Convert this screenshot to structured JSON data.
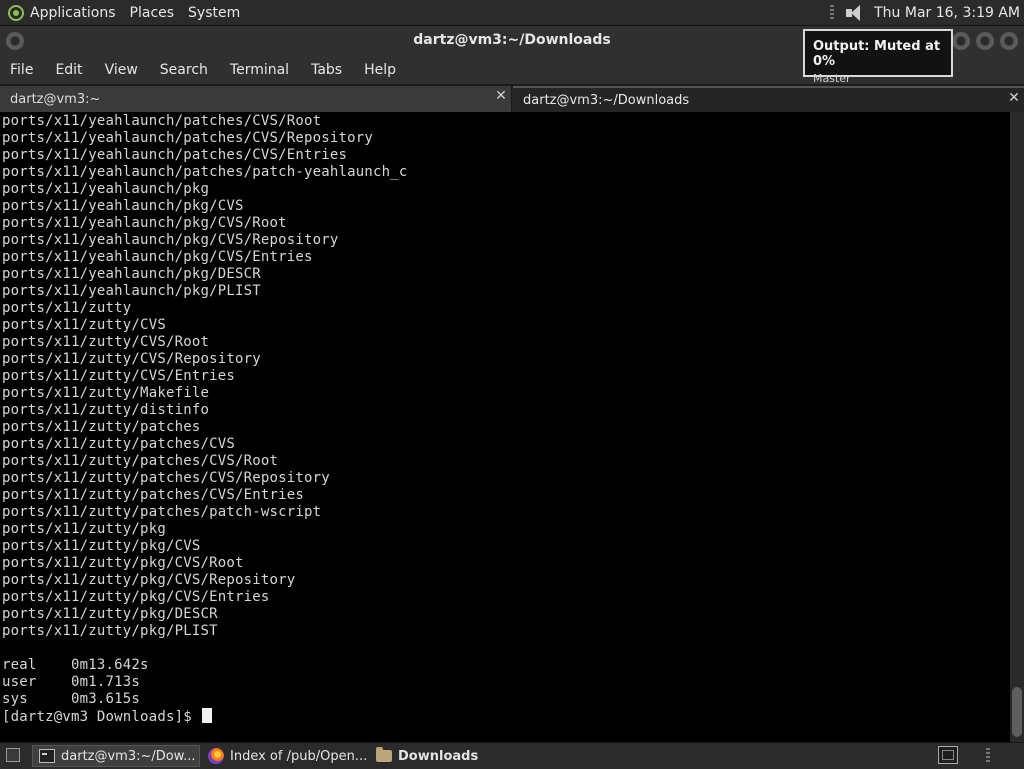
{
  "top_panel": {
    "menus": [
      "Applications",
      "Places",
      "System"
    ],
    "clock": "Thu Mar 16,  3:19 AM"
  },
  "window": {
    "title": "dartz@vm3:~/Downloads",
    "menu": [
      "File",
      "Edit",
      "View",
      "Search",
      "Terminal",
      "Tabs",
      "Help"
    ],
    "tabs": [
      {
        "label": "dartz@vm3:~",
        "active": false
      },
      {
        "label": "dartz@vm3:~/Downloads",
        "active": true
      }
    ]
  },
  "terminal": {
    "lines": [
      "ports/x11/yeahlaunch/patches/CVS/Root",
      "ports/x11/yeahlaunch/patches/CVS/Repository",
      "ports/x11/yeahlaunch/patches/CVS/Entries",
      "ports/x11/yeahlaunch/patches/patch-yeahlaunch_c",
      "ports/x11/yeahlaunch/pkg",
      "ports/x11/yeahlaunch/pkg/CVS",
      "ports/x11/yeahlaunch/pkg/CVS/Root",
      "ports/x11/yeahlaunch/pkg/CVS/Repository",
      "ports/x11/yeahlaunch/pkg/CVS/Entries",
      "ports/x11/yeahlaunch/pkg/DESCR",
      "ports/x11/yeahlaunch/pkg/PLIST",
      "ports/x11/zutty",
      "ports/x11/zutty/CVS",
      "ports/x11/zutty/CVS/Root",
      "ports/x11/zutty/CVS/Repository",
      "ports/x11/zutty/CVS/Entries",
      "ports/x11/zutty/Makefile",
      "ports/x11/zutty/distinfo",
      "ports/x11/zutty/patches",
      "ports/x11/zutty/patches/CVS",
      "ports/x11/zutty/patches/CVS/Root",
      "ports/x11/zutty/patches/CVS/Repository",
      "ports/x11/zutty/patches/CVS/Entries",
      "ports/x11/zutty/patches/patch-wscript",
      "ports/x11/zutty/pkg",
      "ports/x11/zutty/pkg/CVS",
      "ports/x11/zutty/pkg/CVS/Root",
      "ports/x11/zutty/pkg/CVS/Repository",
      "ports/x11/zutty/pkg/CVS/Entries",
      "ports/x11/zutty/pkg/DESCR",
      "ports/x11/zutty/pkg/PLIST",
      "",
      "real    0m13.642s",
      "user    0m1.713s",
      "sys     0m3.615s"
    ],
    "prompt": "[dartz@vm3 Downloads]$ "
  },
  "notification": {
    "title": "Output: Muted at 0%",
    "body": "Master"
  },
  "taskbar": {
    "items": [
      {
        "label": "dartz@vm3:~/Dow...",
        "icon": "terminal-icon",
        "active": true
      },
      {
        "label": "Index of /pub/Open...",
        "icon": "firefox-icon",
        "active": false
      },
      {
        "label": "Downloads",
        "icon": "folder-icon",
        "active": false
      }
    ]
  }
}
